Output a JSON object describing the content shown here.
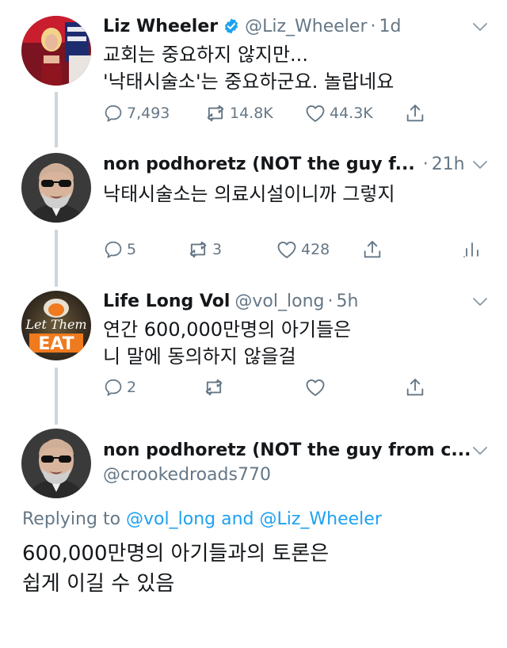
{
  "tweets": [
    {
      "name": "Liz Wheeler",
      "handle": "@Liz_Wheeler",
      "time": "1d",
      "text": "교회는 중요하지 않지만...\n'낙태시술소'는 중요하군요. 놀랍네요",
      "replies": "7,493",
      "retweets": "14.8K",
      "likes": "44.3K"
    },
    {
      "name": "non podhoretz (NOT the guy f...",
      "time": "21h",
      "text": "낙태시술소는 의료시설이니까 그렇지",
      "replies": "5",
      "retweets": "3",
      "likes": "428"
    },
    {
      "name": "Life Long Vol",
      "handle": "@vol_long",
      "time": "5h",
      "text": "연간 600,000만명의 아기들은\n니 말에 동의하지 않을걸",
      "replies": "2",
      "avatar_text": "Let Them EAT"
    },
    {
      "name": "non podhoretz (NOT the guy from c...",
      "handle": "@crookedroads770",
      "replying_prefix": "Replying to",
      "mention1": "@vol_long",
      "and": "and",
      "mention2": "@Liz_Wheeler",
      "text": "600,000만명의 아기들과의 토론은\n쉽게 이길 수 있음"
    }
  ],
  "colors": {
    "text": "#14171a",
    "secondary": "#657786",
    "link": "#1da1f2",
    "thread_line": "#ccd6dd"
  }
}
